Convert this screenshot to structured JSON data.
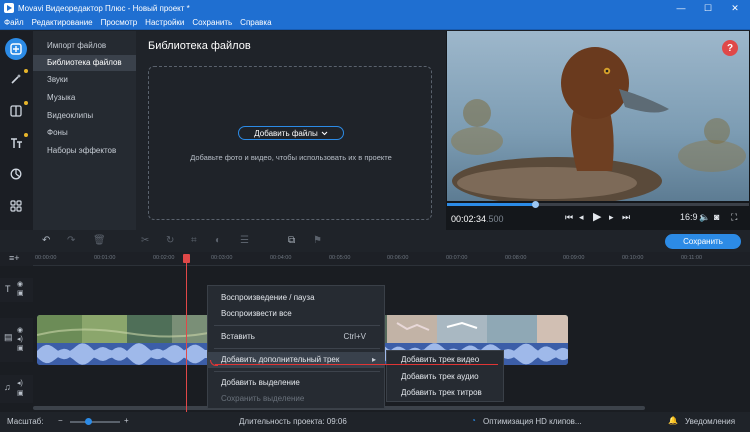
{
  "window": {
    "title": "Movavi Видеоредактор Плюс - Новый проект *",
    "minimize_glyph": "—",
    "maximize_glyph": "☐",
    "close_glyph": "✕"
  },
  "menu": [
    "Файл",
    "Редактирование",
    "Просмотр",
    "Настройки",
    "Сохранить",
    "Справка"
  ],
  "side_icons": [
    "import-icon",
    "magic-wand-icon",
    "transitions-icon",
    "titles-icon",
    "stickers-icon",
    "more-tools-icon"
  ],
  "nav": {
    "items": [
      "Импорт файлов",
      "Библиотека файлов",
      "Звуки",
      "Музыка",
      "Видеоклипы",
      "Фоны",
      "Наборы эффектов"
    ],
    "active_index": 1
  },
  "library": {
    "title": "Библиотека файлов",
    "add_button": "Добавить файлы",
    "hint": "Добавьте фото и видео, чтобы использовать их в проекте"
  },
  "player": {
    "help_label": "?",
    "time": "00:02:34",
    "frames": ".500",
    "aspect": "16:9",
    "progress": 0.29
  },
  "timeline": {
    "save_button": "Сохранить",
    "ruler_ticks": [
      "00:00:00",
      "00:01:00",
      "00:02:00",
      "00:03:00",
      "00:04:00",
      "00:05:00",
      "00:06:00",
      "00:07:00",
      "00:08:00",
      "00:09:00",
      "00:10:00",
      "00:11:00"
    ],
    "playhead_position": 0.217
  },
  "context_menu": {
    "items": [
      {
        "label": "Воспроизведение / пауза",
        "shortcut": ""
      },
      {
        "label": "Воспроизвести все",
        "shortcut": ""
      },
      {
        "label": "Вставить",
        "shortcut": "Ctrl+V"
      },
      {
        "label": "Добавить дополнительный трек",
        "shortcut": ""
      },
      {
        "label": "Добавить выделение",
        "shortcut": ""
      },
      {
        "label": "Сохранить выделение",
        "shortcut": ""
      }
    ],
    "submenu": [
      "Добавить трек видео",
      "Добавить трек аудио",
      "Добавить трек титров"
    ]
  },
  "status": {
    "scale_label": "Масштаб:",
    "duration": "Длительность проекта: 09:06",
    "hd_label": "Оптимизация HD клипов...",
    "notifications": "Уведомления"
  },
  "colors": {
    "accent": "#2c8be6",
    "titlebar": "#1f6fd1",
    "playhead": "#e04848",
    "annotation": "#e03535"
  }
}
